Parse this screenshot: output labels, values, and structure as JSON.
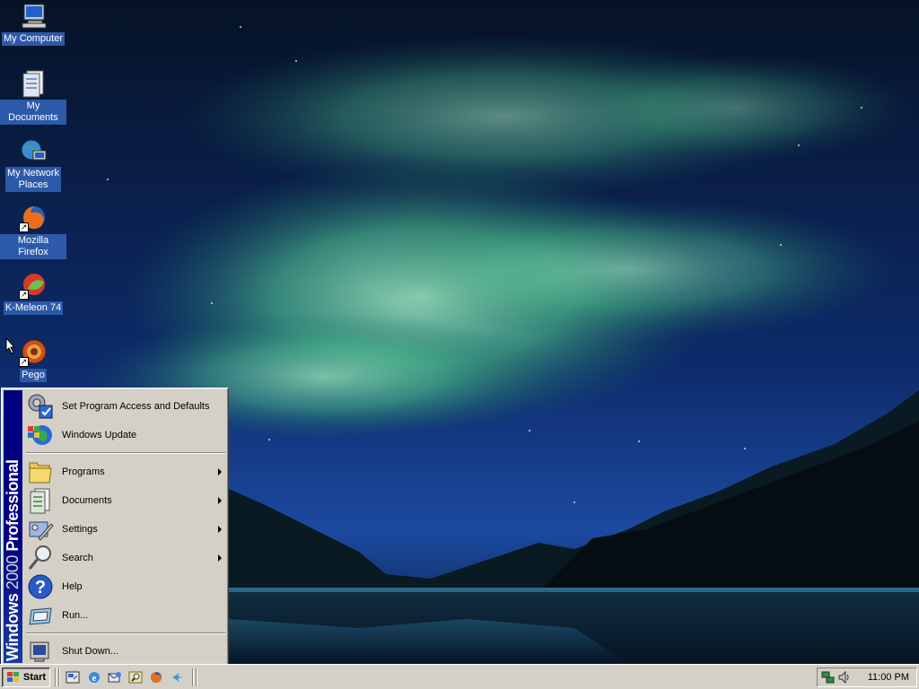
{
  "desktop": {
    "icons": [
      {
        "label": "My Computer",
        "icon": "my-computer-icon"
      },
      {
        "label": "My Documents",
        "icon": "my-documents-icon"
      },
      {
        "label": "My Network\nPlaces",
        "icon": "network-places-icon"
      },
      {
        "label": "Mozilla Firefox",
        "icon": "firefox-icon",
        "shortcut": true
      },
      {
        "label": "K-Meleon 74",
        "icon": "k-meleon-icon",
        "shortcut": true
      },
      {
        "label": "Pego",
        "icon": "pego-icon",
        "shortcut": true
      }
    ]
  },
  "start_menu": {
    "banner_bold": "Windows",
    "banner_version": "2000",
    "banner_edition": "Professional",
    "items": [
      {
        "label": "Set Program Access and Defaults",
        "icon": "program-access-icon",
        "submenu": false
      },
      {
        "label": "Windows Update",
        "icon": "windows-update-icon",
        "submenu": false
      },
      {
        "label": "Programs",
        "icon": "programs-folder-icon",
        "submenu": true
      },
      {
        "label": "Documents",
        "icon": "documents-icon",
        "submenu": true
      },
      {
        "label": "Settings",
        "icon": "settings-icon",
        "submenu": true
      },
      {
        "label": "Search",
        "icon": "search-icon",
        "submenu": true
      },
      {
        "label": "Help",
        "icon": "help-icon",
        "submenu": false
      },
      {
        "label": "Run...",
        "icon": "run-icon",
        "submenu": false
      },
      {
        "label": "Shut Down...",
        "icon": "shut-down-icon",
        "submenu": false
      }
    ]
  },
  "taskbar": {
    "start_label": "Start",
    "quick_launch": [
      "show-desktop-icon",
      "internet-explorer-icon",
      "outlook-express-icon",
      "explorer-search-icon",
      "firefox-icon",
      "k-meleon-quick-icon"
    ],
    "tray_icons": [
      "network-tray-icon",
      "volume-tray-icon"
    ],
    "clock": "11:00 PM"
  },
  "colors": {
    "desktop_label_bg": "#2d5aa8",
    "menu_bg": "#d4d0c8",
    "banner": "#000080"
  }
}
